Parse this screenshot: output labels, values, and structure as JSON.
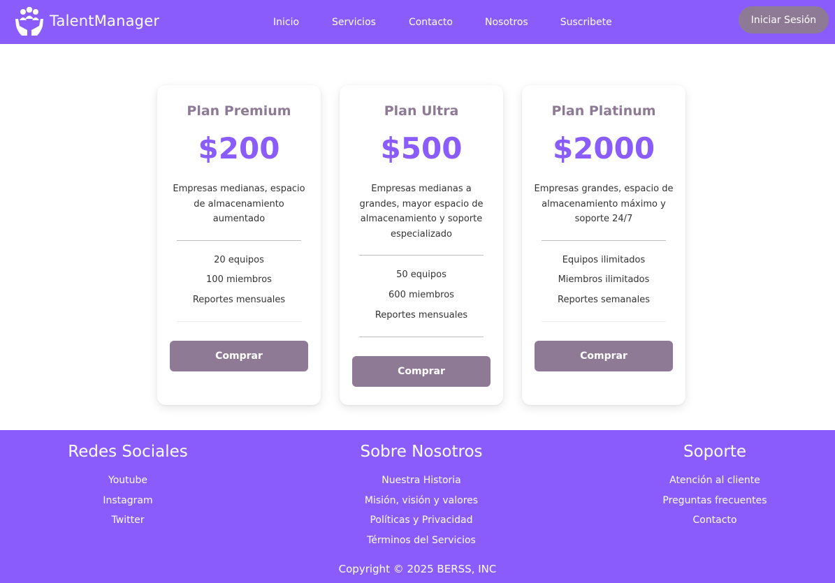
{
  "header": {
    "brand": "TalentManager",
    "nav": [
      "Inicio",
      "Servicios",
      "Contacto",
      "Nosotros",
      "Suscribete"
    ],
    "login_label": "Iniciar Sesión"
  },
  "plans": [
    {
      "title": "Plan Premium",
      "price": "$200",
      "description": "Empresas medianas, espacio de almacenamiento aumentado",
      "features": [
        "20 equipos",
        "100 miembros",
        "Reportes mensuales"
      ],
      "button": "Comprar"
    },
    {
      "title": "Plan Ultra",
      "price": "$500",
      "description": "Empresas medianas a grandes, mayor espacio de almacenamiento y soporte especializado",
      "features": [
        "50 equipos",
        "600 miembros",
        "Reportes mensuales"
      ],
      "button": "Comprar"
    },
    {
      "title": "Plan Platinum",
      "price": "$2000",
      "description": "Empresas grandes, espacio de almacenamiento máximo y soporte 24/7",
      "features": [
        "Equipos ilimitados",
        "Miembros ilimitados",
        "Reportes semanales"
      ],
      "button": "Comprar"
    }
  ],
  "footer": {
    "columns": [
      {
        "title": "Redes Sociales",
        "links": [
          "Youtube",
          "Instagram",
          "Twitter"
        ]
      },
      {
        "title": "Sobre Nosotros",
        "links": [
          "Nuestra Historia",
          "Misión, visión y valores",
          "Políticas y Privacidad",
          "Términos del Servicios"
        ]
      },
      {
        "title": "Soporte",
        "links": [
          "Atención al cliente",
          "Preguntas frecuentes",
          "Contacto"
        ]
      }
    ],
    "copyright": "Copyright © 2025 BERSS, INC"
  },
  "colors": {
    "brand_purple": "#8a5cfc",
    "muted_mauve": "#8f7a96"
  },
  "icons": {
    "logo": "team-hands-icon"
  }
}
